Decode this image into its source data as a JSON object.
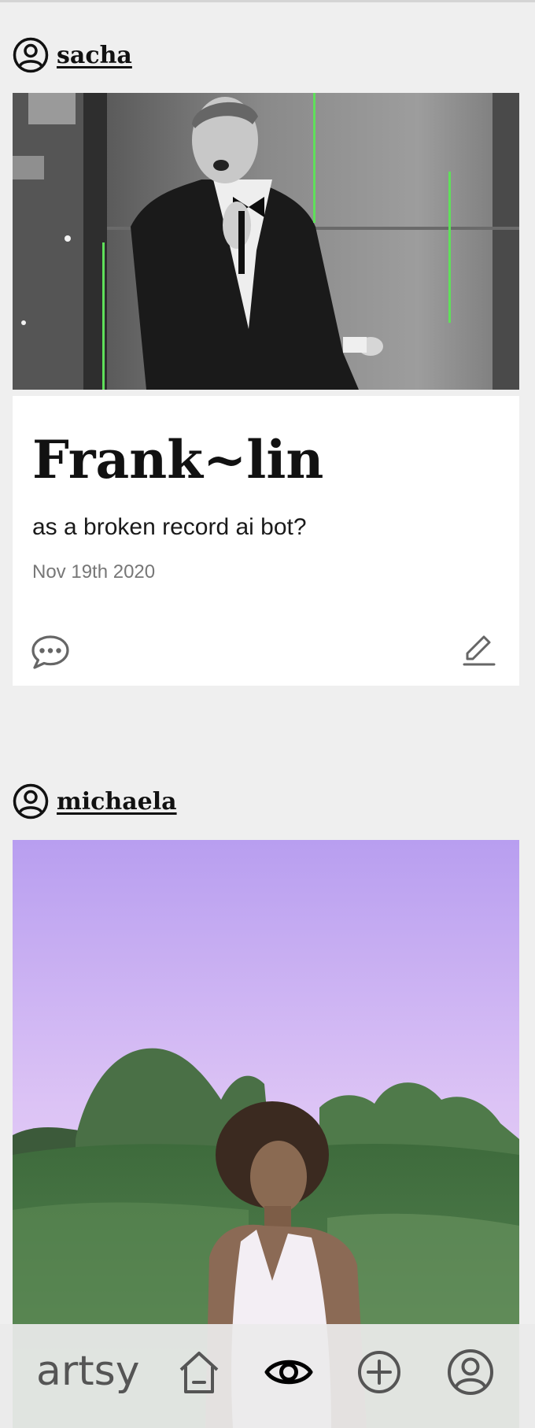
{
  "posts": [
    {
      "author": "sacha",
      "title": "Frank~lin",
      "subtitle": "as a broken record ai bot?",
      "date": "Nov 19th 2020"
    },
    {
      "author": "michaela"
    }
  ],
  "nav": {
    "brand": "artsy",
    "items": [
      "home-icon",
      "eye-icon",
      "plus-circle-icon",
      "profile-icon"
    ],
    "active": "eye-icon"
  },
  "colors": {
    "background": "#efefef",
    "card": "#ffffff",
    "text": "#111111",
    "muted": "#777777",
    "nav_icon": "#555555",
    "nav_active": "#000000",
    "glitch_line": "#5fe05a"
  }
}
